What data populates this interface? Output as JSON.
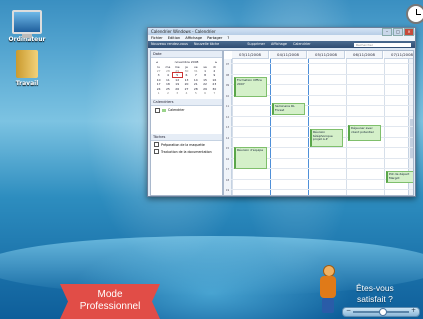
{
  "desktop": {
    "icons": [
      {
        "label": "Ordinateur",
        "icon": "computer-icon"
      },
      {
        "label": "Travail",
        "icon": "folder-icon"
      }
    ]
  },
  "window": {
    "title": "Calendrier Windows - Calendrier",
    "menu": [
      "Fichier",
      "Edition",
      "Affichage",
      "Partager",
      "?"
    ],
    "toolbar": [
      "Nouveau rendez-vous",
      "Nouvelle tâche",
      "Supprimer",
      "Affichage",
      "Calendrier"
    ],
    "search_placeholder": "Rechercher"
  },
  "left_pane": {
    "date_header": "Date",
    "month_label": "novembre 2008",
    "weekday_headers": [
      "lu",
      "ma",
      "me",
      "je",
      "ve",
      "sa",
      "di"
    ],
    "calendar_days": [
      "27",
      "28",
      "29",
      "30",
      "31",
      "1",
      "2",
      "3",
      "4",
      "5",
      "6",
      "7",
      "8",
      "9",
      "10",
      "11",
      "12",
      "13",
      "14",
      "15",
      "16",
      "17",
      "18",
      "19",
      "20",
      "21",
      "22",
      "23",
      "24",
      "25",
      "26",
      "27",
      "28",
      "29",
      "30",
      "1",
      "2",
      "3",
      "4",
      "5",
      "6",
      "7"
    ],
    "today_index": 9,
    "calendars_header": "Calendriers",
    "calendar_name": "Calendrier",
    "tasks_header": "Tâches",
    "tasks": [
      "Préparation de la maquette",
      "Traduction de la documentation"
    ]
  },
  "main": {
    "day_headers": [
      "03/11/2008",
      "04/11/2008",
      "05/11/2008",
      "06/11/2008",
      "07/11/2008"
    ],
    "hour_labels": [
      "07",
      "08",
      "09",
      "10",
      "11",
      "12",
      "13",
      "14",
      "15",
      "16",
      "17",
      "18",
      "19"
    ],
    "events": [
      {
        "day": 0,
        "text": "Formation Office 2007"
      },
      {
        "day": 1,
        "text": "Séminaire RL Forest"
      },
      {
        "day": 0,
        "text": "Réunion d'équipe"
      },
      {
        "day": 2,
        "text": "Réunion téléphonique projet A-P"
      },
      {
        "day": 3,
        "text": "Déjeuner avec client potentiel"
      },
      {
        "day": 4,
        "text": "Pot de départ Margot"
      }
    ]
  },
  "footer": {
    "mode_line1": "Mode",
    "mode_line2": "Professionnel",
    "prompt_line1": "Êtes-vous",
    "prompt_line2": "satisfait ?"
  }
}
